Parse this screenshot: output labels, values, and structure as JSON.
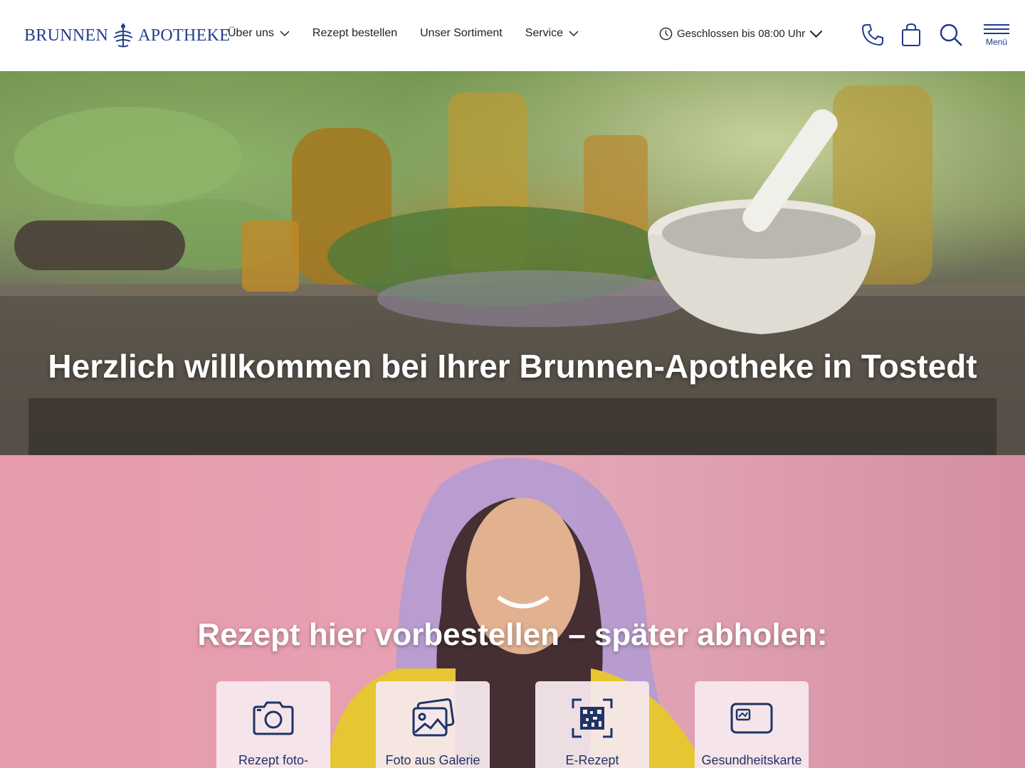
{
  "brand": {
    "left": "BRUNNEN",
    "right": "APOTHEKE",
    "color": "#243d8c"
  },
  "nav": {
    "items": [
      {
        "label": "Über uns",
        "has_dropdown": true
      },
      {
        "label": "Rezept bestellen",
        "has_dropdown": false
      },
      {
        "label": "Unser Sortiment",
        "has_dropdown": false
      },
      {
        "label": "Service",
        "has_dropdown": true
      }
    ]
  },
  "hours": {
    "label": "Geschlossen bis 08:00 Uhr",
    "icon": "clock-icon"
  },
  "header_icons": [
    "phone-icon",
    "shopping-bag-icon",
    "search-icon"
  ],
  "menu": {
    "label": "Menü"
  },
  "hero": {
    "title": "Herzlich willkommen bei Ihrer Brunnen-Apotheke in Tostedt"
  },
  "rx": {
    "title": "Rezept hier vorbestellen – später abholen:",
    "cards": [
      {
        "label": "Rezept foto-\ngrafieren",
        "icon": "camera-icon"
      },
      {
        "label": "Foto aus Galerie\nhochladen",
        "icon": "gallery-icon"
      },
      {
        "label": "E-Rezept",
        "icon": "qr-code-icon"
      },
      {
        "label": "Gesundheitskarte",
        "icon": "health-card-icon"
      }
    ]
  },
  "colors": {
    "accent": "#1f3a8a",
    "rx_bg": "#e79aab"
  }
}
